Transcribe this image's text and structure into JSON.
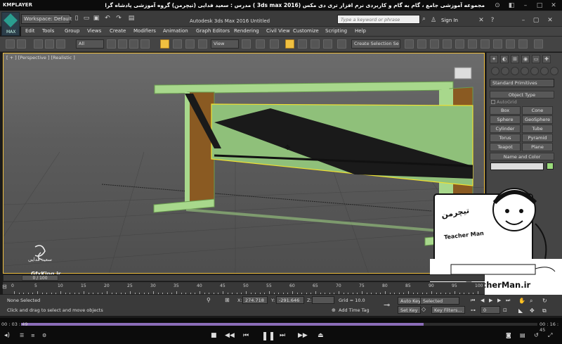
{
  "kmplayer": {
    "logo": "KMPLAYER",
    "title": "مجموعه آموزشی جامع ، گام به گام و کاربردی نرم افزار تری دی مکس (3ds max 2016 ) مدرس : سعید فدایی (تیچرمن) گروه آموزشی پادشاه گرافیست ها"
  },
  "max": {
    "logo_label": "MAX",
    "workspace": "Workspace: Default",
    "app_title": "Autodesk 3ds Max 2016      Untitled",
    "search_placeholder": "Type a keyword or phrase",
    "signin": "Sign In",
    "menu": [
      "Edit",
      "Tools",
      "Group",
      "Views",
      "Create",
      "Modifiers",
      "Animation",
      "Graph Editors",
      "Rendering",
      "Civil View",
      "Customize",
      "Scripting",
      "Help"
    ],
    "toolbar": {
      "filter": "All",
      "view": "View",
      "selection_set": "Create Selection Se"
    },
    "viewport_label": "[ + ] [Perspective ] [Realistic ]",
    "panel": {
      "category": "Standard Primitives",
      "object_type_header": "Object Type",
      "autogrid": "AutoGrid",
      "buttons": [
        "Box",
        "Cone",
        "Sphere",
        "GeoSphere",
        "Cylinder",
        "Tube",
        "Torus",
        "Pyramid",
        "Teapot",
        "Plane"
      ],
      "name_color_header": "Name and Color"
    },
    "timeline": {
      "frame": "0 / 100",
      "ticks": [
        "0",
        "5",
        "10",
        "15",
        "20",
        "25",
        "30",
        "35",
        "40",
        "45",
        "50",
        "55",
        "60",
        "65",
        "70",
        "75",
        "80",
        "85",
        "90",
        "95",
        "100"
      ]
    },
    "status": {
      "selected": "None Selected",
      "prompt": "Click and drag to select and move objects",
      "x_label": "X:",
      "x": "274.718",
      "y_label": "Y:",
      "y": "-291.646",
      "z_label": "Z:",
      "z": "",
      "grid": "Grid = 10.0",
      "add_time_tag": "Add Time Tag",
      "auto_key": "Auto Key",
      "set_key": "Set Key",
      "key_mode": "Selected",
      "key_filters": "Key Filters...",
      "current_frame": "0"
    }
  },
  "overlay": {
    "left_name": "سعید فدایی",
    "left_site": "GfxKing.ir",
    "teacher_logo": "تیچرمن",
    "teacher_name": "Teacher Man",
    "teacher_url": "www.TeacherMan.ir"
  },
  "player": {
    "elapsed": "00 : 03 : 49",
    "total": "00 : 16 : 45",
    "progress_percent": 78
  }
}
